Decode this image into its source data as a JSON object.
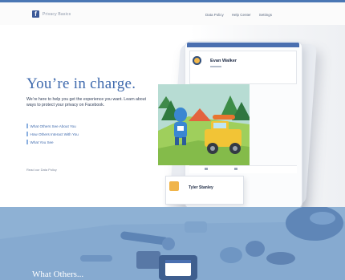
{
  "nav": {
    "brand_text": "f Privacy Basics",
    "links": [
      "Data Policy",
      "Help Center",
      "Settings"
    ]
  },
  "hero": {
    "headline": "You’re in charge.",
    "intro": "We’re here to help you get the experience you want. Learn about ways to protect your privacy on Facebook.",
    "links": [
      "What Others See About You",
      "How Others Interact With You",
      "What You See"
    ],
    "policy_link": "Read our Data Policy"
  },
  "phone": {
    "post1_name": "Evan Walker",
    "post2_name": "Tyler Stanley"
  },
  "bottom": {
    "title": "What Others..."
  },
  "colors": {
    "accent": "#3f6aad",
    "band": "#8eb1d4",
    "brand": "#3b5998"
  }
}
